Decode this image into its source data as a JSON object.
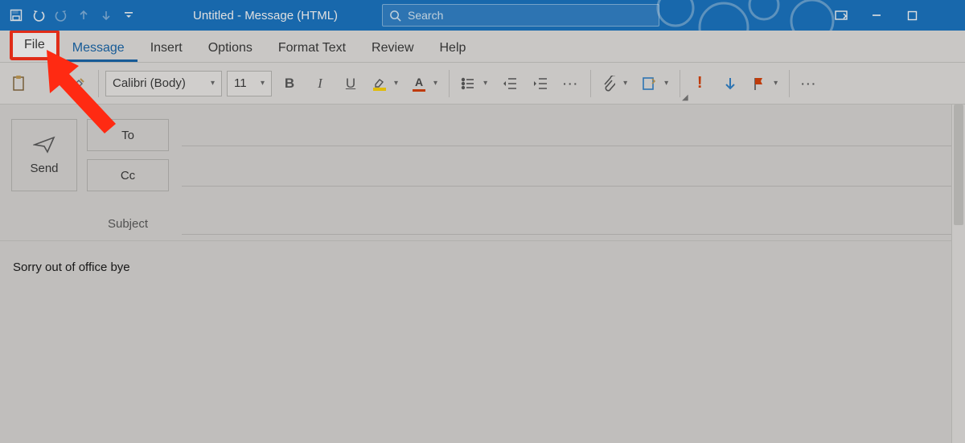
{
  "title": "Untitled  -  Message (HTML)",
  "search": {
    "placeholder": "Search"
  },
  "tabs": {
    "file": "File",
    "message": "Message",
    "insert": "Insert",
    "options": "Options",
    "format": "Format Text",
    "review": "Review",
    "help": "Help"
  },
  "ribbon": {
    "font_name": "Calibri (Body)",
    "font_size": "11"
  },
  "compose": {
    "send": "Send",
    "to": "To",
    "cc": "Cc",
    "subject_label": "Subject",
    "to_value": "",
    "cc_value": "",
    "subject_value": ""
  },
  "body_text": "Sorry out of office bye"
}
